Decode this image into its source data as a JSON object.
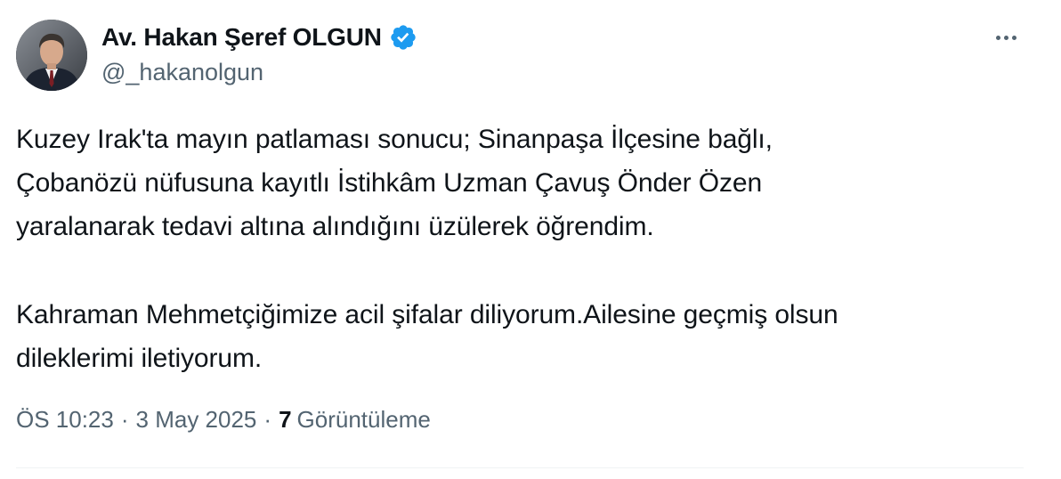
{
  "colors": {
    "text_primary": "#0f1419",
    "text_secondary": "#536471",
    "verified_badge": "#1d9bf0",
    "divider": "#eff3f4"
  },
  "author": {
    "display_name": "Av. Hakan Şeref OLGUN",
    "handle": "@_hakanolgun",
    "verified_icon": "verified-badge-icon",
    "avatar_icon": "profile-photo"
  },
  "menu": {
    "icon": "more-horizontal-icon"
  },
  "tweet": {
    "paragraphs": [
      [
        "Kuzey Irak'ta mayın patlaması sonucu; Sinanpaşa İlçesine bağlı,",
        "Çobanözü nüfusuna kayıtlı İstihkâm Uzman Çavuş Önder Özen",
        "yaralanarak tedavi altına alındığını üzülerek öğrendim."
      ],
      [
        "Kahraman Mehmetçiğimize acil şifalar diliyorum.Ailesine geçmiş olsun",
        "dileklerimi iletiyorum."
      ]
    ]
  },
  "meta": {
    "time": "ÖS 10:23",
    "separator": "·",
    "date": "3 May 2025",
    "views_count": "7",
    "views_label": "Görüntüleme"
  }
}
